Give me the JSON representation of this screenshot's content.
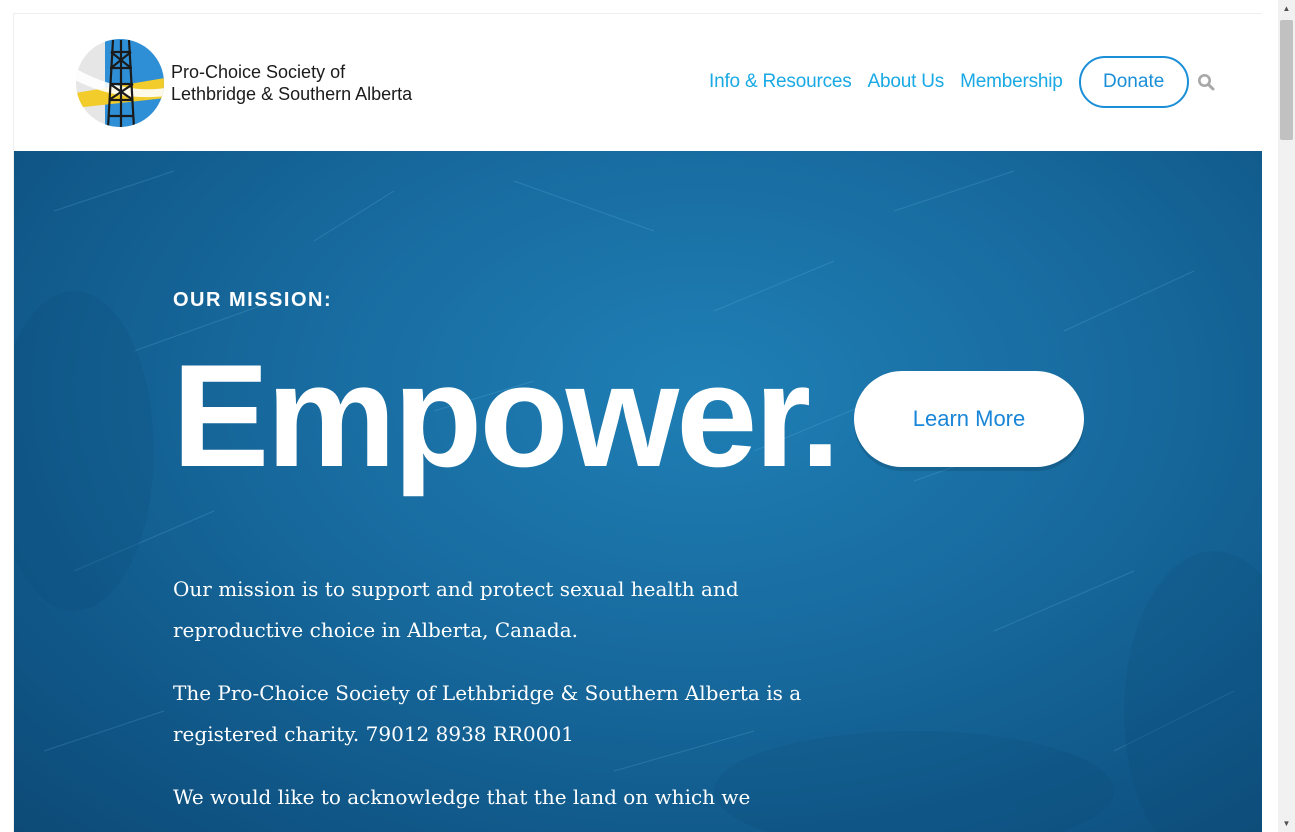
{
  "site": {
    "logo_line1": "Pro-Choice Society of",
    "logo_line2": "Lethbridge & Southern Alberta"
  },
  "nav": {
    "items": [
      {
        "label": "Info & Resources"
      },
      {
        "label": "About Us"
      },
      {
        "label": "Membership"
      }
    ],
    "donate_label": "Donate",
    "search_icon": "search-icon"
  },
  "hero": {
    "eyebrow": "OUR MISSION:",
    "headline": "Empower.",
    "cta_label": "Learn More",
    "paragraphs": [
      "Our mission is to support and protect sexual health and reproductive choice in Alberta, Canada.",
      "The Pro-Choice Society of Lethbridge & Southern Alberta is a registered charity. 79012 8938 RR0001",
      "We would like to acknowledge that the land on which we"
    ]
  },
  "colors": {
    "nav_link": "#19a9e4",
    "donate_border": "#1a8fd8",
    "hero_bg": "#17699d",
    "cta_text": "#1a86d8"
  }
}
